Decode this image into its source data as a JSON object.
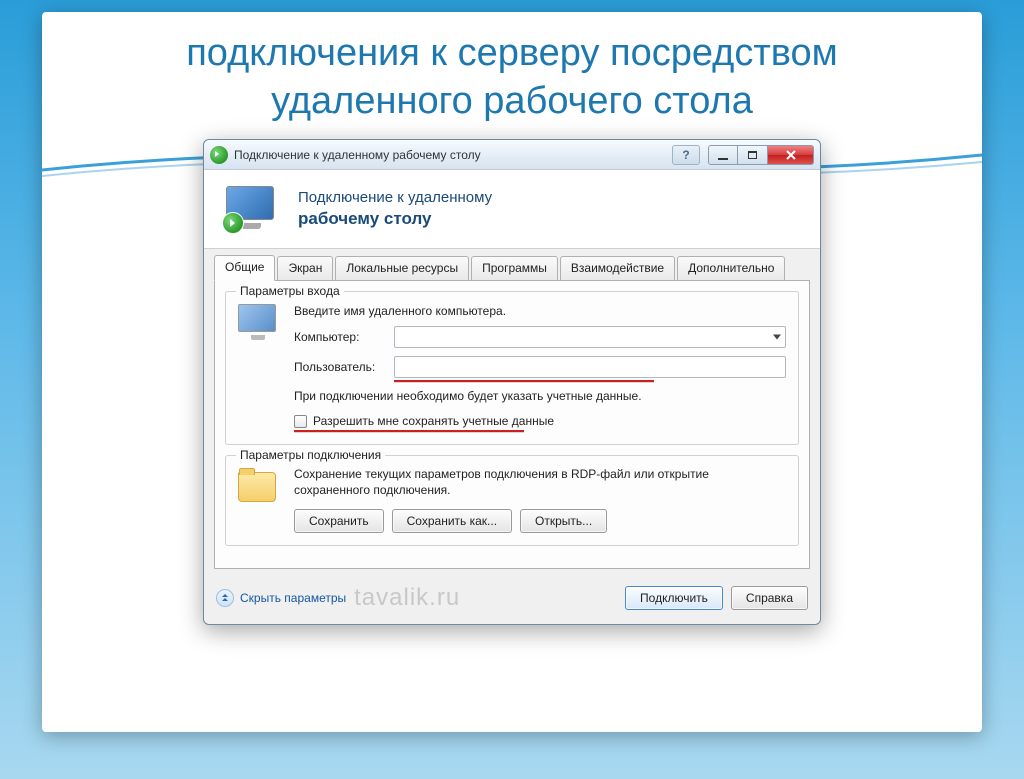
{
  "slide": {
    "title": "подключения к серверу посредством удаленного рабочего стола"
  },
  "window": {
    "title": "Подключение к удаленному рабочему столу",
    "banner_line1": "Подключение к удаленному",
    "banner_line2": "рабочему столу"
  },
  "tabs": [
    {
      "label": "Общие",
      "active": true
    },
    {
      "label": "Экран",
      "active": false
    },
    {
      "label": "Локальные ресурсы",
      "active": false
    },
    {
      "label": "Программы",
      "active": false
    },
    {
      "label": "Взаимодействие",
      "active": false
    },
    {
      "label": "Дополнительно",
      "active": false
    }
  ],
  "login_group": {
    "legend": "Параметры входа",
    "instruction": "Введите имя удаленного компьютера.",
    "computer_label": "Компьютер:",
    "computer_value": "",
    "user_label": "Пользователь:",
    "user_value": "",
    "note": "При подключении необходимо будет указать учетные данные.",
    "allow_save_label": "Разрешить мне сохранять учетные данные"
  },
  "conn_group": {
    "legend": "Параметры подключения",
    "note": "Сохранение текущих параметров подключения в RDP-файл или открытие сохраненного подключения.",
    "save": "Сохранить",
    "save_as": "Сохранить как...",
    "open": "Открыть..."
  },
  "footer": {
    "collapse": "Скрыть параметры",
    "connect": "Подключить",
    "help": "Справка"
  },
  "watermark": "tavalik.ru"
}
